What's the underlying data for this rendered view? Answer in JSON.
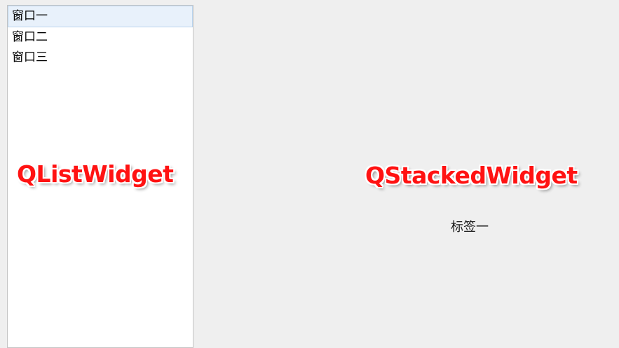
{
  "list_widget": {
    "items": [
      {
        "label": "窗口一",
        "selected": true
      },
      {
        "label": "窗口二",
        "selected": false
      },
      {
        "label": "窗口三",
        "selected": false
      }
    ]
  },
  "stacked_widget": {
    "current_label": "标签一"
  },
  "annotations": {
    "list_widget": "QListWidget",
    "stacked_widget": "QStackedWidget",
    "color": "#ff1212"
  }
}
